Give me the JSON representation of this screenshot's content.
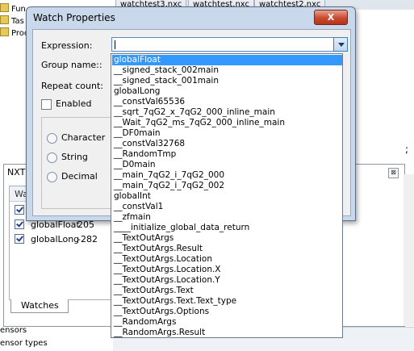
{
  "sidebar_tree": {
    "items": [
      {
        "label": "Fun"
      },
      {
        "label": "Tas"
      },
      {
        "label": "Proc"
      }
    ]
  },
  "file_tabs": [
    {
      "label": "watchtest3.nxc"
    },
    {
      "label": "watchtest.nxc"
    },
    {
      "label": "watchtest2.nxc"
    }
  ],
  "editor": {
    "visible_text": ";"
  },
  "nxt_window": {
    "title": "NXT",
    "close_glyph": "⊠",
    "header_label": "Watc",
    "rows": [
      {
        "name": "",
        "value": ""
      },
      {
        "name": "globalFloat",
        "value": "205"
      },
      {
        "name": "globalLong",
        "value": "-282"
      }
    ],
    "tab_label": "Watches"
  },
  "bottom_panel": {
    "lines": [
      "ensors",
      "ensor types"
    ]
  },
  "dialog": {
    "title": "Watch Properties",
    "close_label": "X",
    "expression_label": "Expression:",
    "expression_value": "",
    "group_name_label": "Group name::",
    "repeat_count_label": "Repeat count:",
    "enabled_label": "Enabled",
    "format_options": [
      {
        "label": "Character"
      },
      {
        "label": "String"
      },
      {
        "label": "Decimal"
      }
    ]
  },
  "dropdown": {
    "selected_index": 0,
    "options": [
      "globalFloat",
      "__signed_stack_002main",
      "__signed_stack_001main",
      "globalLong",
      "__constVal65536",
      "__sqrt_7qG2_x_7qG2_000_inline_main",
      "__Wait_7qG2_ms_7qG2_000_inline_main",
      "__DF0main",
      "__constVal32768",
      "__RandomTmp",
      "__D0main",
      "__main_7qG2_i_7qG2_000",
      "__main_7qG2_i_7qG2_002",
      "globalInt",
      "__constVal1",
      "__zfmain",
      "____initialize_global_data_return",
      "__TextOutArgs",
      "__TextOutArgs.Result",
      "__TextOutArgs.Location",
      "__TextOutArgs.Location.X",
      "__TextOutArgs.Location.Y",
      "__TextOutArgs.Text",
      "__TextOutArgs.Text.Text_type",
      "__TextOutArgs.Options",
      "__RandomArgs",
      "__RandomArgs.Result"
    ]
  },
  "colors": {
    "selection": "#3399ff",
    "dialog_frame": "#c9d8ea",
    "close_button": "#c74b2f"
  }
}
